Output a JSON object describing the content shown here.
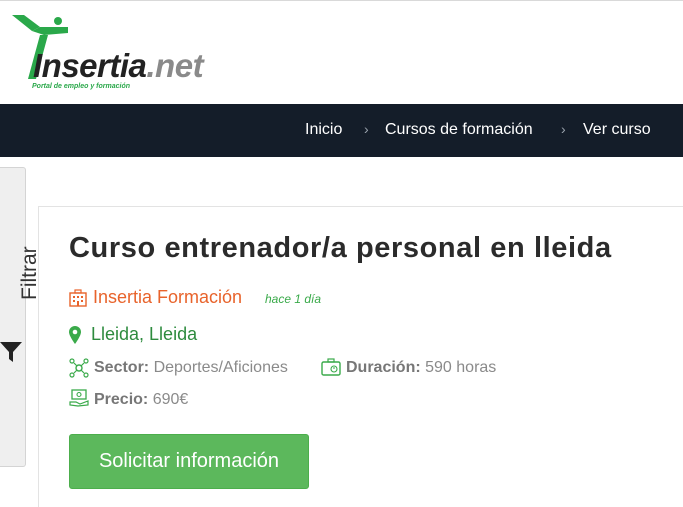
{
  "header": {
    "logo_text_main": "Insertia",
    "logo_text_suffix": ".net",
    "logo_tagline": "Portal de empleo y formación"
  },
  "nav": {
    "items": [
      {
        "label": "Inicio"
      },
      {
        "label": "Cursos de formación"
      },
      {
        "label": "Ver curso"
      }
    ]
  },
  "sidebar": {
    "filter_label": "Filtrar"
  },
  "course": {
    "title": "Curso entrenador/a personal en lleida",
    "company": "Insertia Formación",
    "posted_ago": "hace 1 día",
    "location": "Lleida, Lleida",
    "sector_label": "Sector:",
    "sector_value": "Deportes/Aficiones",
    "duration_label": "Duración:",
    "duration_value": "590 horas",
    "price_label": "Precio:",
    "price_value": "690€",
    "cta_label": "Solicitar información"
  },
  "colors": {
    "brand_green": "#2aa84a",
    "navbar_bg": "#141d29",
    "company_orange": "#e8632b",
    "button_green": "#5cb85c"
  }
}
